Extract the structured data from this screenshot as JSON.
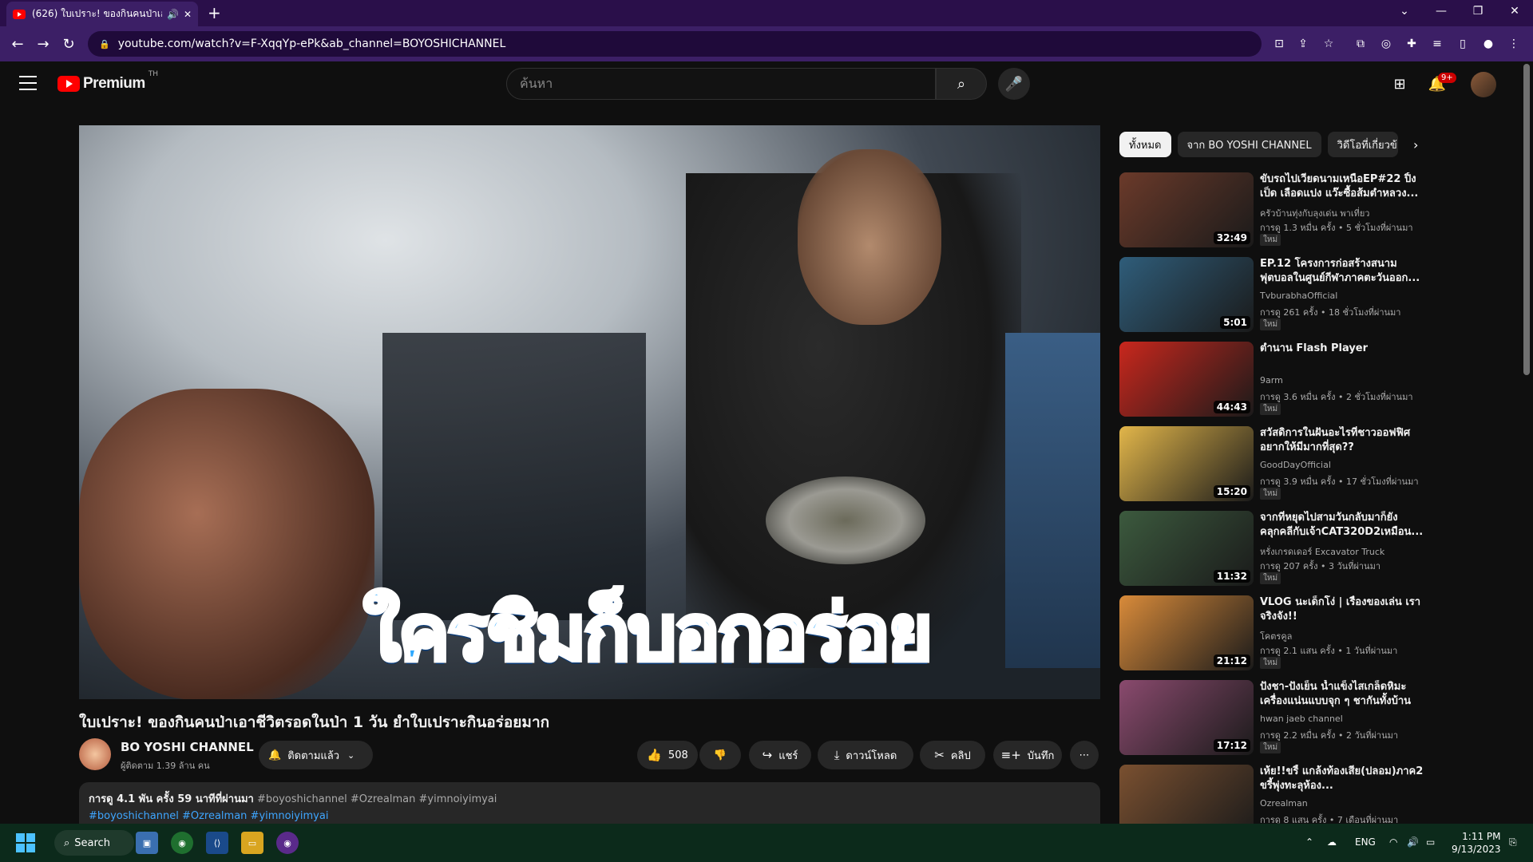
{
  "browser": {
    "tab_title": "(626) ใบเปราะ! ของกินคนป่าเอาชีวิ",
    "tab_sound_icon": "speaker-icon",
    "url": "youtube.com/watch?v=F-XqqYp-ePk&ab_channel=BOYOSHICHANNEL",
    "new_tab_label": "+"
  },
  "youtube": {
    "logo_text": "Premium",
    "logo_sup": "TH",
    "search_placeholder": "ค้นหา",
    "notif_count": "9+"
  },
  "video": {
    "caption": "ใครชิมก็บอกอร่อย",
    "title": "ใบเปราะ! ของกินคนป่าเอาชีวิตรอดในป่า 1 วัน ยำใบเปราะกินอร่อยมาก",
    "channel_name": "BO YOSHI CHANNEL",
    "subscribers": "ผู้ติดตาม 1.39 ล้าน คน",
    "subscribed_label": "ติดตามแล้ว",
    "likes": "508",
    "share_label": "แชร์",
    "download_label": "ดาวน์โหลด",
    "clip_label": "คลิป",
    "save_label": "บันทึก",
    "desc_meta": "การดู 4.1 พัน ครั้ง  59 นาทีที่ผ่านมา",
    "desc_tags_inline": "#boyoshichannel #Ozrealman #yimnoiyimyai",
    "desc_tag1": "#boyoshichannel",
    "desc_tag2": "#Ozrealman",
    "desc_tag3": "#yimnoiyimyai"
  },
  "chips": [
    "ทั้งหมด",
    "จาก BO YOSHI CHANNEL",
    "วิดีโอที่เกี่ยวข้อง"
  ],
  "recommendations": [
    {
      "title": "ขับรถไปเวียดนามเหนือEP#22 ปิ้งเป็ด เลือดแปง แว๊ะซื้อส้มตำหลวง...",
      "channel": "ครัวบ้านทุ่งกับลุงเด่น พาเที่ยว",
      "meta": "การดู 1.3 หมื่น ครั้ง  • 5 ชั่วโมงที่ผ่านมา",
      "badge": "ใหม่",
      "duration": "32:49",
      "thumb": "#6b3a2a"
    },
    {
      "title": "EP.12 โครงการก่อสร้างสนามฟุตบอลในศูนย์กีฬาภาคตะวันออก...",
      "channel": "TvburabhaOfficial",
      "meta": "การดู 261 ครั้ง  • 18 ชั่วโมงที่ผ่านมา",
      "badge": "ใหม่",
      "duration": "5:01",
      "thumb": "#2f5d7a"
    },
    {
      "title": "ตำนาน Flash Player",
      "channel": "9arm",
      "meta": "การดู 3.6 หมื่น ครั้ง  • 2 ชั่วโมงที่ผ่านมา",
      "badge": "ใหม่",
      "duration": "44:43",
      "thumb": "#c9271d"
    },
    {
      "title": "สวัสดิการในฝันอะไรที่ชาวออฟฟิศอยากให้มีมากที่สุด??",
      "channel": "GoodDayOfficial",
      "meta": "การดู 3.9 หมื่น ครั้ง  • 17 ชั่วโมงที่ผ่านมา",
      "badge": "ใหม่",
      "duration": "15:20",
      "thumb": "#e2b64a"
    },
    {
      "title": "จากที่หยุดไปสามวันกลับมาก็ยังคลุกคลีกับเจ้าCAT320D2เหมือน...",
      "channel": "หรั่งเกรดเดอร์ Excavator Truck",
      "meta": "การดู 207 ครั้ง  • 3 วันที่ผ่านมา",
      "badge": "ใหม่",
      "duration": "11:32",
      "thumb": "#3c5a3e"
    },
    {
      "title": "VLOG นะเด็กโง่ | เรื่องของเล่น เราจริงจัง!!",
      "channel": "โคตรคูล",
      "meta": "การดู 2.1 แสน ครั้ง  • 1 วันที่ผ่านมา",
      "badge": "ใหม่",
      "duration": "21:12",
      "thumb": "#d98b3a"
    },
    {
      "title": "ปังชา-ปังเย็น น้ำแข็งไสเกล็ดหิมะ เครื่องแน่นแบบจุก ๆ ชากันทั้งบ้าน",
      "channel": "hwan jaeb channel",
      "meta": "การดู 2.2 หมื่น ครั้ง  • 2 วันที่ผ่านมา",
      "badge": "ใหม่",
      "duration": "17:12",
      "thumb": "#8a4a6e"
    },
    {
      "title": "เห้ย!!ขรี้ แกล้งท้องเสีย(ปลอม)ภาค2 ขรี้พุ่งทะลุห้อง...",
      "channel": "Ozrealman",
      "meta": "การดู 8 แสน ครั้ง  • 7 เดือนที่ผ่านมา",
      "badge": "",
      "duration": "",
      "thumb": "#7a5030"
    }
  ],
  "taskbar": {
    "search_label": "Search",
    "lang": "ENG",
    "time": "1:11 PM",
    "date": "9/13/2023"
  }
}
